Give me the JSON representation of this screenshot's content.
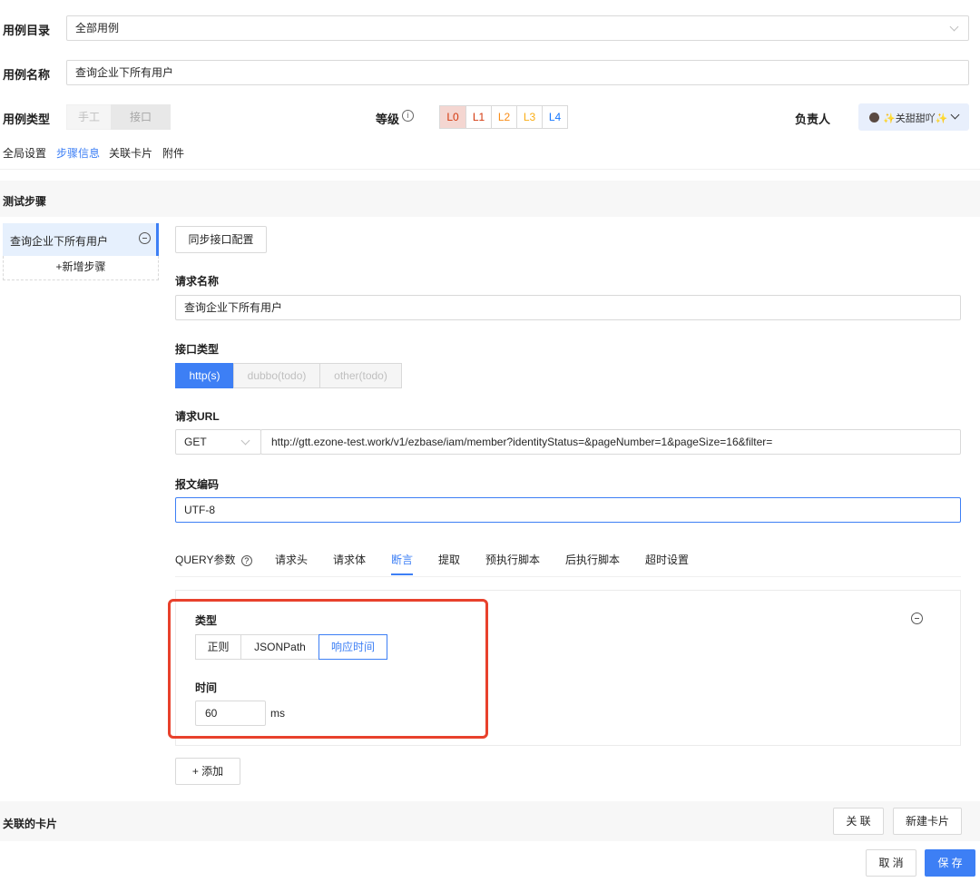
{
  "form": {
    "catalog": {
      "label": "用例目录",
      "value": "全部用例"
    },
    "name": {
      "label": "用例名称",
      "value": "查询企业下所有用户"
    },
    "type": {
      "label": "用例类型",
      "options": [
        "手工",
        "接口"
      ],
      "selected": "接口"
    },
    "level": {
      "label": "等级",
      "options": [
        "L0",
        "L1",
        "L2",
        "L3",
        "L4"
      ],
      "selected": "L0",
      "colors": [
        "#d4380d",
        "#d4380d",
        "#fa8c16",
        "#faad14",
        "#1677ff"
      ]
    },
    "owner": {
      "label": "负责人",
      "value": "✨关甜甜吖✨"
    }
  },
  "top_tabs": [
    "全局设置",
    "步骤信息",
    "关联卡片",
    "附件"
  ],
  "top_tab_active": "步骤信息",
  "steps_section": {
    "title": "测试步骤",
    "items": [
      "查询企业下所有用户"
    ],
    "add_label": "+新增步骤"
  },
  "step_detail": {
    "sync_button": "同步接口配置",
    "request_name": {
      "label": "请求名称",
      "value": "查询企业下所有用户"
    },
    "interface_type": {
      "label": "接口类型",
      "options": [
        "http(s)",
        "dubbo(todo)",
        "other(todo)"
      ],
      "selected": "http(s)"
    },
    "request_url": {
      "label": "请求URL",
      "method": "GET",
      "url": "http://gtt.ezone-test.work/v1/ezbase/iam/member?identityStatus=&pageNumber=1&pageSize=16&filter="
    },
    "encoding": {
      "label": "报文编码",
      "value": "UTF-8"
    },
    "tabs": [
      "QUERY参数",
      "请求头",
      "请求体",
      "断言",
      "提取",
      "预执行脚本",
      "后执行脚本",
      "超时设置"
    ],
    "active_tab": "断言",
    "assertion": {
      "type_label": "类型",
      "type_options": [
        "正则",
        "JSONPath",
        "响应时间"
      ],
      "type_selected": "响应时间",
      "time_label": "时间",
      "time_value": "60",
      "time_unit": "ms"
    },
    "add_button": "+ 添加"
  },
  "linked_cards": {
    "title": "关联的卡片",
    "link_button": "关 联",
    "new_button": "新建卡片"
  },
  "footer": {
    "cancel": "取 消",
    "save": "保 存"
  },
  "colors": {
    "primary": "#3d7ff5",
    "highlight": "#e8412c"
  }
}
